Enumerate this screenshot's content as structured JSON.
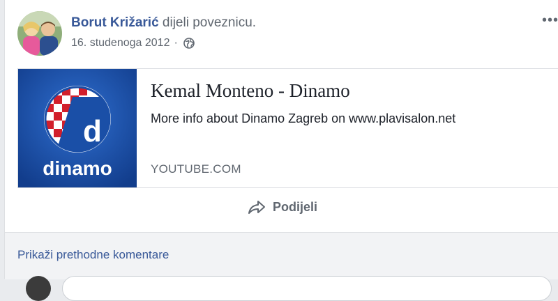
{
  "post": {
    "author": "Borut Križarić",
    "action": "dijeli poveznicu.",
    "date": "16. studenoga 2012",
    "separator": "·",
    "privacy_icon": "globe-icon",
    "menu_icon": "more-dots-icon"
  },
  "link": {
    "title": "Kemal Monteno - Dinamo",
    "description": "More info about Dinamo Zagreb on www.plavisalon.net",
    "domain": "YOUTUBE.COM",
    "thumbnail_logo_text": "dinamo",
    "thumbnail_color": "#1a4fa7"
  },
  "actions": {
    "share_label": "Podijeli",
    "share_icon": "share-arrow-icon"
  },
  "comments": {
    "show_previous": "Prikaži prethodne komentare"
  },
  "colors": {
    "link_blue": "#385898",
    "secondary_text": "#606770",
    "background": "#e9ebee"
  }
}
